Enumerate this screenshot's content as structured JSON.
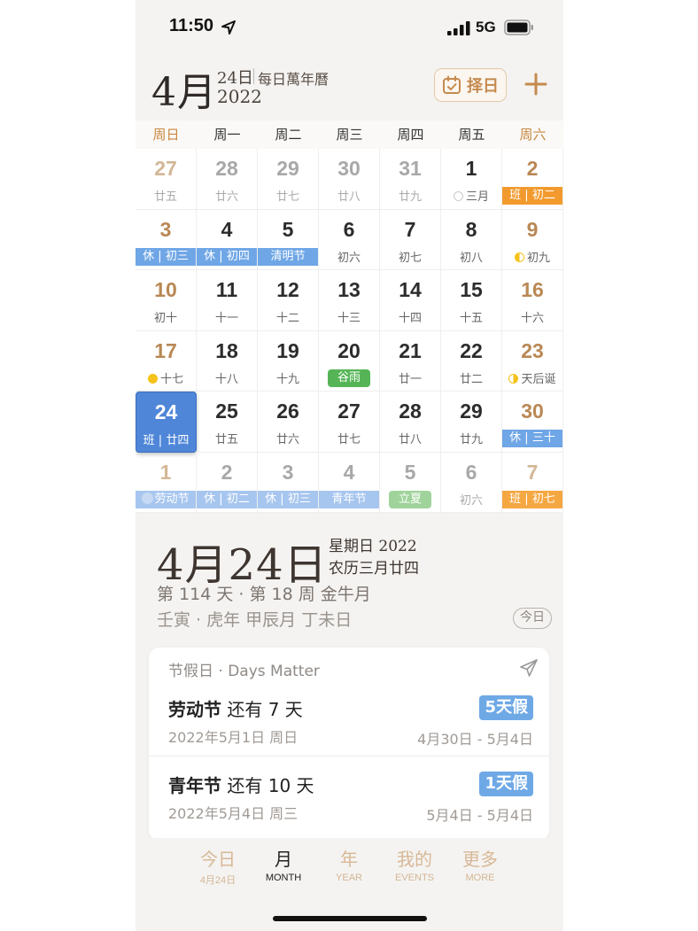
{
  "status": {
    "time": "11:50",
    "network": "5G"
  },
  "header": {
    "month": "4月",
    "day": "24日",
    "app_name": "每日萬年曆",
    "year": "2022",
    "choose_day_label": "择日"
  },
  "weekdays": [
    "周日",
    "周一",
    "周二",
    "周三",
    "周四",
    "周五",
    "周六"
  ],
  "calendar": {
    "rows": [
      [
        {
          "d": "27",
          "l": "廿五",
          "other": true
        },
        {
          "d": "28",
          "l": "廿六",
          "other": true
        },
        {
          "d": "29",
          "l": "廿七",
          "other": true
        },
        {
          "d": "30",
          "l": "廿八",
          "other": true
        },
        {
          "d": "31",
          "l": "廿九",
          "other": true
        },
        {
          "d": "1",
          "l": "三月",
          "moon": "new"
        },
        {
          "d": "2",
          "l": "班 | 初二",
          "band": "work"
        }
      ],
      [
        {
          "d": "3",
          "l": "休 | 初三",
          "band": "rest"
        },
        {
          "d": "4",
          "l": "休 | 初四",
          "band": "rest"
        },
        {
          "d": "5",
          "l": "清明节",
          "band": "festival"
        },
        {
          "d": "6",
          "l": "初六"
        },
        {
          "d": "7",
          "l": "初七"
        },
        {
          "d": "8",
          "l": "初八"
        },
        {
          "d": "9",
          "l": "初九",
          "moon": "first"
        }
      ],
      [
        {
          "d": "10",
          "l": "初十"
        },
        {
          "d": "11",
          "l": "十一"
        },
        {
          "d": "12",
          "l": "十二"
        },
        {
          "d": "13",
          "l": "十三"
        },
        {
          "d": "14",
          "l": "十四"
        },
        {
          "d": "15",
          "l": "十五"
        },
        {
          "d": "16",
          "l": "十六"
        }
      ],
      [
        {
          "d": "17",
          "l": "十七",
          "moon": "full"
        },
        {
          "d": "18",
          "l": "十八"
        },
        {
          "d": "19",
          "l": "十九"
        },
        {
          "d": "20",
          "l": "谷雨",
          "band": "term"
        },
        {
          "d": "21",
          "l": "廿一"
        },
        {
          "d": "22",
          "l": "廿二"
        },
        {
          "d": "23",
          "l": "天后诞",
          "moon": "last"
        }
      ],
      [
        {
          "d": "24",
          "l": "班 | 廿四",
          "selected": true
        },
        {
          "d": "25",
          "l": "廿五"
        },
        {
          "d": "26",
          "l": "廿六"
        },
        {
          "d": "27",
          "l": "廿七"
        },
        {
          "d": "28",
          "l": "廿八"
        },
        {
          "d": "29",
          "l": "廿九"
        },
        {
          "d": "30",
          "l": "休 | 三十",
          "band": "rest"
        }
      ],
      [
        {
          "d": "1",
          "l": "劳动节",
          "band": "rest",
          "dot": true,
          "other": true
        },
        {
          "d": "2",
          "l": "休 | 初二",
          "band": "rest",
          "other": true
        },
        {
          "d": "3",
          "l": "休 | 初三",
          "band": "rest",
          "other": true
        },
        {
          "d": "4",
          "l": "青年节",
          "band": "festival",
          "other": true
        },
        {
          "d": "5",
          "l": "立夏",
          "band": "term",
          "other": true
        },
        {
          "d": "6",
          "l": "初六",
          "other": true
        },
        {
          "d": "7",
          "l": "班 | 初七",
          "band": "work",
          "other": true
        }
      ]
    ]
  },
  "detail": {
    "big_date": "4月24日",
    "weekday_year": "星期日 2022",
    "lunar": "农历三月廿四",
    "week_info": "第 114 天 · 第 18 周 金牛月",
    "ganzhi": "壬寅 · 虎年 甲辰月 丁未日",
    "today_label": "今日"
  },
  "days_matter": {
    "title": "节假日 · Days Matter",
    "events": [
      {
        "name": "劳动节",
        "remain": "还有 7 天",
        "date": "2022年5月1日 周日",
        "badge": "5天假",
        "range": "4月30日 - 5月4日"
      },
      {
        "name": "青年节",
        "remain": "还有 10 天",
        "date": "2022年5月4日 周三",
        "badge": "1天假",
        "range": "5月4日 - 5月4日"
      }
    ]
  },
  "tabs": [
    {
      "label": "今日",
      "sub": "4月24日"
    },
    {
      "label": "月",
      "sub": "MONTH",
      "active": true
    },
    {
      "label": "年",
      "sub": "YEAR"
    },
    {
      "label": "我的",
      "sub": "EVENTS"
    },
    {
      "label": "更多",
      "sub": "MORE"
    }
  ]
}
